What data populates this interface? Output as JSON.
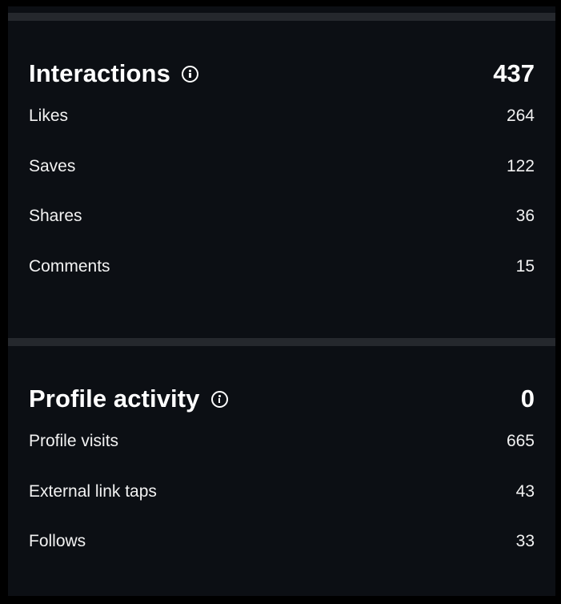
{
  "interactions": {
    "title": "Interactions",
    "info_icon": "info-circle-icon",
    "total": "437",
    "rows": [
      {
        "label": "Likes",
        "value": "264"
      },
      {
        "label": "Saves",
        "value": "122"
      },
      {
        "label": "Shares",
        "value": "36"
      },
      {
        "label": "Comments",
        "value": "15"
      }
    ]
  },
  "profile_activity": {
    "title": "Profile activity",
    "info_icon": "info-circle-icon",
    "total": "0",
    "rows": [
      {
        "label": "Profile visits",
        "value": "665"
      },
      {
        "label": "External link taps",
        "value": "43"
      },
      {
        "label": "Follows",
        "value": "33"
      }
    ]
  },
  "colors": {
    "background": "#000000",
    "panel": "#0c0f14",
    "divider": "#25282d",
    "text": "#ffffff"
  }
}
